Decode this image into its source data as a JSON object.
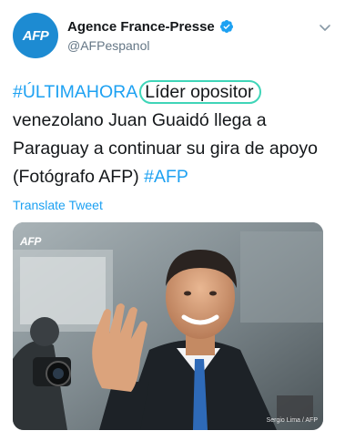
{
  "account": {
    "avatar_text": "AFP",
    "display_name": "Agence France-Presse",
    "handle": "@AFPespanol",
    "verified": true
  },
  "tweet": {
    "hashtag_breaking": "#ÚLTIMAHORA",
    "circled_phrase": "Líder opositor",
    "body": "venezolano Juan Guaidó llega a Paraguay a continuar su gira de apoyo (Fotógrafo AFP)",
    "hashtag_afp": "#AFP"
  },
  "translate_label": "Translate Tweet",
  "media": {
    "watermark": "AFP",
    "credit": "Sergio Lima / AFP"
  },
  "colors": {
    "link": "#1da1f2",
    "avatar": "#1d8bd2",
    "highlight_circle": "#3fd5b8"
  }
}
